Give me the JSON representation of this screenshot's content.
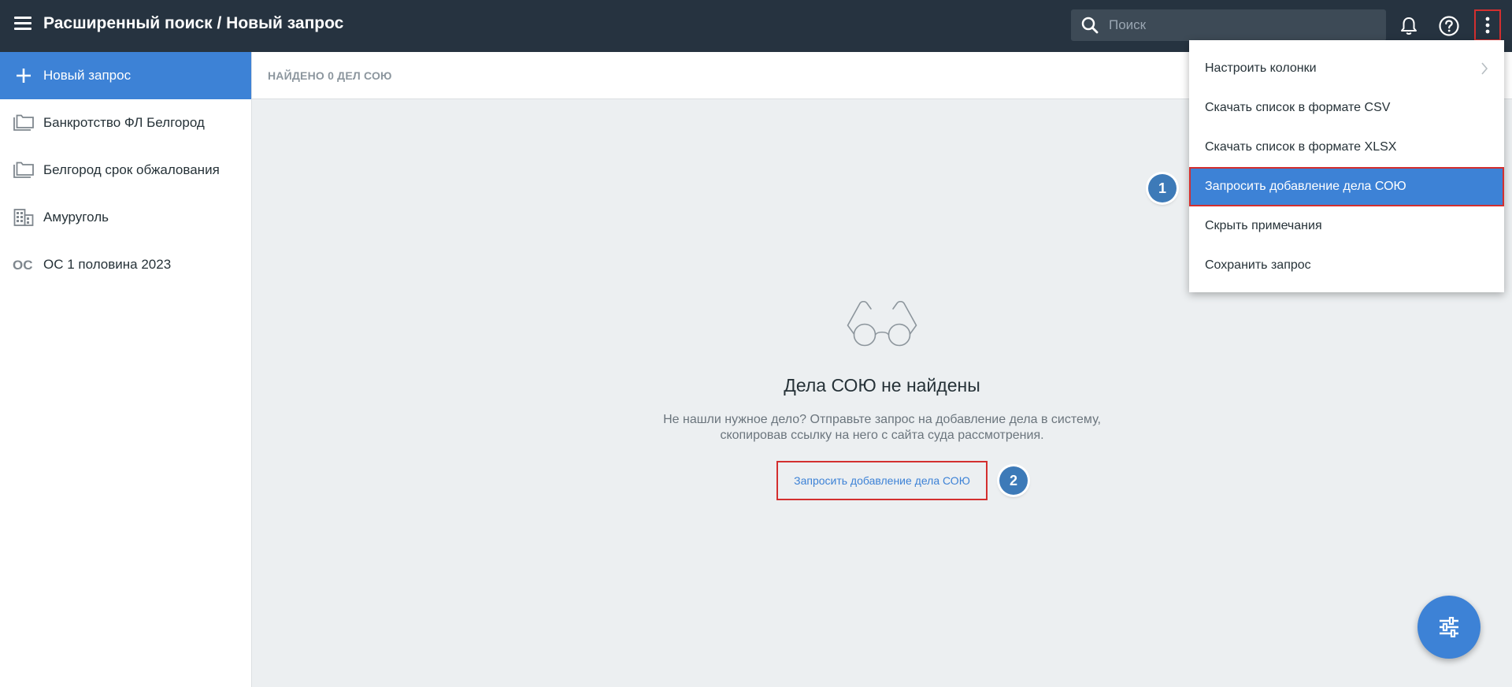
{
  "header": {
    "title": "Расширенный поиск / Новый запрос",
    "search_placeholder": "Поиск",
    "menu_icon": "hamburger-icon",
    "bell_icon": "bell-icon",
    "help_icon": "help-circle-icon",
    "more_icon": "more-vertical-icon"
  },
  "sidebar": {
    "items": [
      {
        "label": "Новый запрос",
        "icon": "plus-icon",
        "active": true
      },
      {
        "label": "Банкротство ФЛ Белгород",
        "icon": "folders-icon"
      },
      {
        "label": "Белгород срок обжалования",
        "icon": "folders-icon"
      },
      {
        "label": "Амуруголь",
        "icon": "building-icon"
      },
      {
        "label": "ОС 1 половина 2023",
        "icon": "oc-icon",
        "icon_text": "OC"
      }
    ]
  },
  "results": {
    "found_label": "НАЙДЕНО 0 ДЕЛ СОЮ"
  },
  "empty_state": {
    "icon": "glasses-icon",
    "title": "Дела СОЮ не найдены",
    "text_line1": "Не нашли нужное дело? Отправьте запрос на добавление дела в систему,",
    "text_line2": "скопировав ссылку на него с сайта суда рассмотрения.",
    "link_label": "Запросить добавление дела СОЮ"
  },
  "menu": {
    "items": [
      {
        "label": "Настроить колонки",
        "has_submenu": true
      },
      {
        "label": "Скачать список в формате CSV"
      },
      {
        "label": "Скачать список в формате XLSX"
      },
      {
        "label": "Запросить добавление дела СОЮ",
        "active": true
      },
      {
        "label": "Скрыть примечания"
      },
      {
        "label": "Сохранить запрос"
      }
    ]
  },
  "annotations": {
    "badge1": "1",
    "badge2": "2"
  },
  "fab_icon": "filter-sliders-icon",
  "colors": {
    "topbar": "#263340",
    "accent": "#3d82d6",
    "highlight_border": "#d32f2f",
    "badge": "#3d7ab8",
    "background": "#eceff1"
  }
}
